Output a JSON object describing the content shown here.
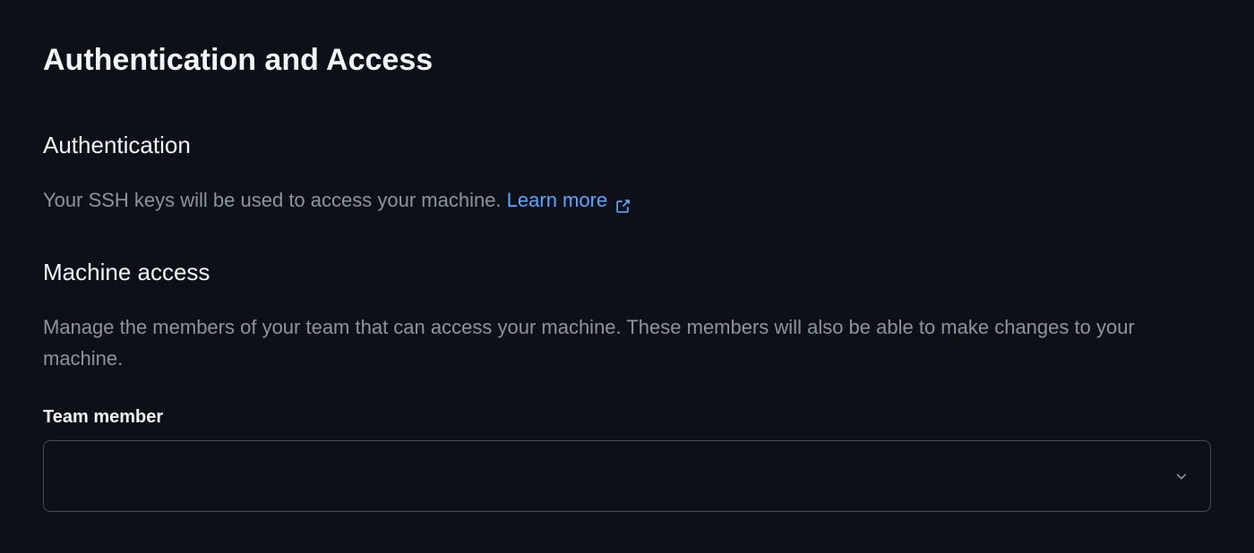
{
  "header": {
    "title": "Authentication and Access"
  },
  "sections": {
    "authentication": {
      "heading": "Authentication",
      "description": "Your SSH keys will be used to access your machine. ",
      "learn_more_label": "Learn more"
    },
    "machine_access": {
      "heading": "Machine access",
      "description": "Manage the members of your team that can access your machine. These members will also be able to make changes to your machine.",
      "team_member_label": "Team member",
      "team_member_value": ""
    }
  }
}
